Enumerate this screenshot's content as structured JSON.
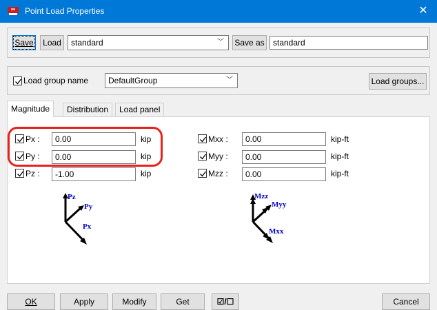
{
  "window": {
    "title": "Point Load Properties",
    "close_glyph": "✕",
    "icon": "app-icon"
  },
  "top": {
    "save_label": "Save",
    "load_label": "Load",
    "load_combo_value": "standard",
    "save_as_label": "Save as",
    "save_as_value": "standard"
  },
  "group": {
    "checkbox_label": "Load group name",
    "combo_value": "DefaultGroup",
    "load_groups_label": "Load groups..."
  },
  "tabs": [
    {
      "label": "Magnitude",
      "active": true
    },
    {
      "label": "Distribution",
      "active": false
    },
    {
      "label": "Load panel",
      "active": false
    }
  ],
  "forces": [
    {
      "label": "Px :",
      "value": "0.00",
      "unit": "kip",
      "checked": true
    },
    {
      "label": "Py :",
      "value": "0.00",
      "unit": "kip",
      "checked": true
    },
    {
      "label": "Pz :",
      "value": "-1.00",
      "unit": "kip",
      "checked": true
    }
  ],
  "moments": [
    {
      "label": "Mxx :",
      "value": "0.00",
      "unit": "kip-ft",
      "checked": true
    },
    {
      "label": "Myy :",
      "value": "0.00",
      "unit": "kip-ft",
      "checked": true
    },
    {
      "label": "Mzz :",
      "value": "0.00",
      "unit": "kip-ft",
      "checked": true
    }
  ],
  "force_diagram": {
    "z": "Pz",
    "y": "Py",
    "x": "Px"
  },
  "moment_diagram": {
    "z": "Mzz",
    "y": "Myy",
    "x": "Mxx"
  },
  "bottom": {
    "ok_label": "OK",
    "apply_label": "Apply",
    "modify_label": "Modify",
    "get_label": "Get",
    "toggle_label": "☑/☐",
    "cancel_label": "Cancel"
  },
  "colors": {
    "titlebar": "#0078d7",
    "highlight": "#e8211d",
    "axis_label": "#0000cc"
  }
}
